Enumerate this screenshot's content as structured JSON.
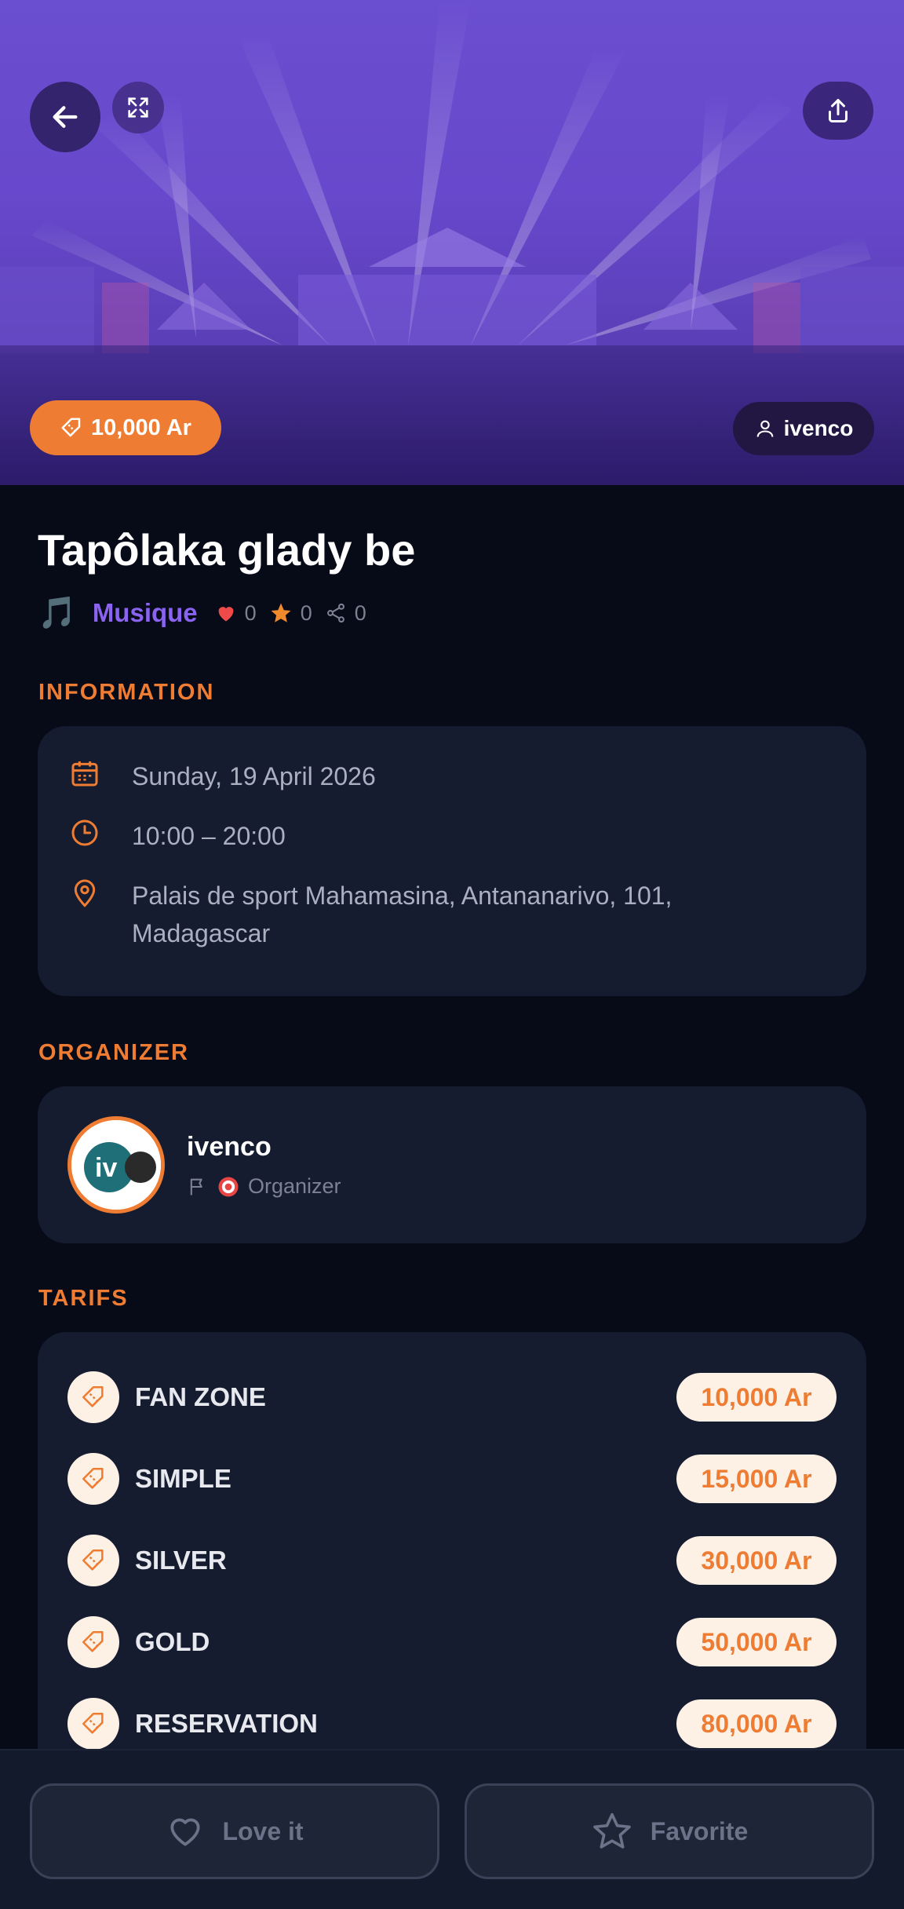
{
  "hero": {
    "price": "10,000 Ar",
    "organizer": "ivenco"
  },
  "event": {
    "title": "Tapôlaka glady be",
    "category": "Musique",
    "category_icon": "music-note-icon",
    "likes": "0",
    "favorites": "0",
    "shares": "0"
  },
  "information": {
    "label": "INFORMATION",
    "date": "Sunday, 19 April 2026",
    "time": "10:00 – 20:00",
    "address_line1": "Palais de sport Mahamasina, Antananarivo, 101,",
    "address_line2": "Madagascar"
  },
  "organizer": {
    "label": "ORGANIZER",
    "name": "ivenco",
    "role": "Organizer",
    "avatar_text": "iv"
  },
  "tarifs": {
    "label": "TARIFS",
    "items": [
      {
        "name": "FAN ZONE",
        "price": "10,000 Ar"
      },
      {
        "name": "SIMPLE",
        "price": "15,000 Ar"
      },
      {
        "name": "SILVER",
        "price": "30,000 Ar"
      },
      {
        "name": "GOLD",
        "price": "50,000 Ar"
      },
      {
        "name": "RESERVATION",
        "price": "80,000 Ar"
      }
    ]
  },
  "actions": {
    "love": "Love it",
    "favorite": "Favorite"
  },
  "colors": {
    "accent": "#ee7d33",
    "category": "#8a63f0",
    "background": "#070a17",
    "card": "#161c2f"
  }
}
